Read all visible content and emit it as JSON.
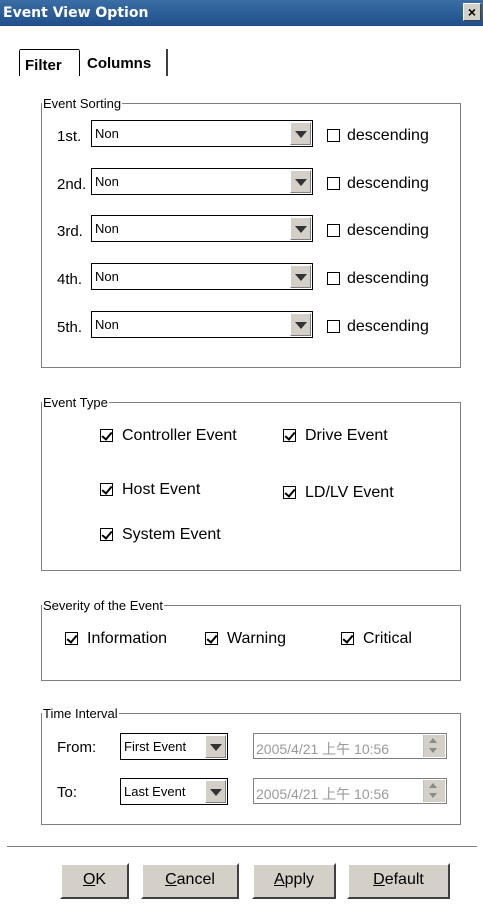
{
  "window": {
    "title": "Event View Option",
    "close_glyph": "×"
  },
  "tabs": [
    {
      "label": "Filter",
      "active": true
    },
    {
      "label": "Columns",
      "active": false
    }
  ],
  "event_sorting": {
    "legend": "Event Sorting",
    "rows": [
      {
        "label": "1st.",
        "value": "Non",
        "descending_label": "descending",
        "descending": false
      },
      {
        "label": "2nd.",
        "value": "Non",
        "descending_label": "descending",
        "descending": false
      },
      {
        "label": "3rd.",
        "value": "Non",
        "descending_label": "descending",
        "descending": false
      },
      {
        "label": "4th.",
        "value": "Non",
        "descending_label": "descending",
        "descending": false
      },
      {
        "label": "5th.",
        "value": "Non",
        "descending_label": "descending",
        "descending": false
      }
    ]
  },
  "event_type": {
    "legend": "Event Type",
    "controller": {
      "label": "Controller Event",
      "checked": true
    },
    "drive": {
      "label": "Drive Event",
      "checked": true
    },
    "host": {
      "label": "Host Event",
      "checked": true
    },
    "ldlv": {
      "label": "LD/LV Event",
      "checked": true
    },
    "system": {
      "label": "System Event",
      "checked": true
    }
  },
  "severity": {
    "legend": "Severity of the Event",
    "information": {
      "label": "Information",
      "checked": true
    },
    "warning": {
      "label": "Warning",
      "checked": true
    },
    "critical": {
      "label": "Critical",
      "checked": true
    }
  },
  "time_interval": {
    "legend": "Time Interval",
    "from_label": "From:",
    "from_value": "First Event",
    "from_time": "2005/4/21 上午 10:56",
    "to_label": "To:",
    "to_value": "Last Event",
    "to_time": "2005/4/21 上午 10:56"
  },
  "buttons": {
    "ok": {
      "mnemonic": "O",
      "rest": "K"
    },
    "cancel": {
      "mnemonic": "C",
      "rest": "ancel"
    },
    "apply": {
      "mnemonic": "A",
      "rest": "pply"
    },
    "default": {
      "mnemonic": "D",
      "rest": "efault"
    }
  },
  "icons": {
    "combo_arrow": "chevron-down-icon",
    "checkbox_mark": "check-icon",
    "spinner": "spinner-icon"
  }
}
